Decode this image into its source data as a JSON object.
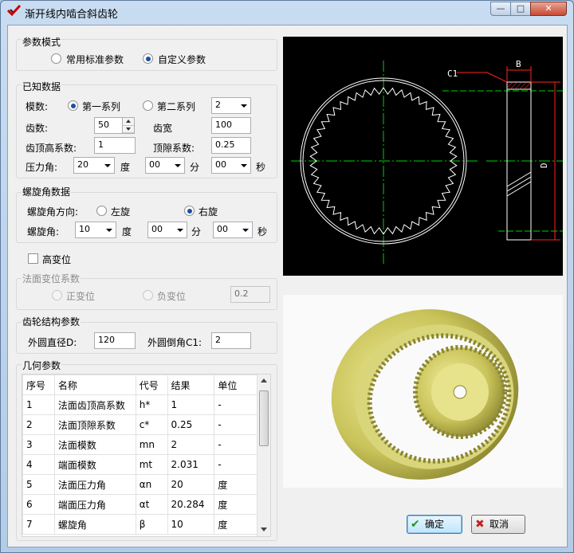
{
  "window": {
    "title": "渐开线内啮合斜齿轮",
    "controls": {
      "minimize": "—",
      "maximize": "□",
      "close": "✕"
    }
  },
  "param_mode": {
    "label": "参数模式",
    "options": [
      {
        "label": "常用标准参数",
        "selected": false
      },
      {
        "label": "自定义参数",
        "selected": true
      }
    ]
  },
  "known_data": {
    "label": "已知数据",
    "module_label": "模数:",
    "series1": "第一系列",
    "series2": "第二系列",
    "module_value": "2",
    "teeth_label": "齿数:",
    "teeth_value": "50",
    "face_width_label": "齿宽",
    "face_width_value": "100",
    "addendum_label": "齿顶高系数:",
    "addendum_value": "1",
    "clearance_label": "顶隙系数:",
    "clearance_value": "0.25",
    "pressure_label": "压力角:",
    "pressure_deg": "20",
    "pressure_min": "00",
    "pressure_sec": "00",
    "deg_unit": "度",
    "min_unit": "分",
    "sec_unit": "秒"
  },
  "helix": {
    "label": "螺旋角数据",
    "direction_label": "螺旋角方向:",
    "left": "左旋",
    "right": "右旋",
    "angle_label": "螺旋角:",
    "deg": "10",
    "min": "00",
    "sec": "00",
    "deg_unit": "度",
    "min_unit": "分",
    "sec_unit": "秒"
  },
  "modification": {
    "high_label": "高变位",
    "normal_label": "法面变位系数",
    "positive": "正变位",
    "negative": "负变位",
    "value": "0.2"
  },
  "structure": {
    "label": "齿轮结构参数",
    "od_label": "外圆直径D:",
    "od_value": "120",
    "chamfer_label": "外圆倒角C1:",
    "chamfer_value": "2"
  },
  "geometry": {
    "label": "几何参数",
    "columns": [
      "序号",
      "名称",
      "代号",
      "结果",
      "单位"
    ],
    "rows": [
      [
        "1",
        "法面齿顶高系数",
        "h*",
        "1",
        "-"
      ],
      [
        "2",
        "法面顶隙系数",
        "c*",
        "0.25",
        "-"
      ],
      [
        "3",
        "法面模数",
        "mn",
        "2",
        "-"
      ],
      [
        "4",
        "端面模数",
        "mt",
        "2.031",
        "-"
      ],
      [
        "5",
        "法面压力角",
        "αn",
        "20",
        "度"
      ],
      [
        "6",
        "端面压力角",
        "αt",
        "20.284",
        "度"
      ],
      [
        "7",
        "螺旋角",
        "β",
        "10",
        "度"
      ]
    ]
  },
  "drawing": {
    "c1": "C1",
    "b": "B",
    "d": "D"
  },
  "buttons": {
    "ok": "确定",
    "cancel": "取消"
  },
  "colors": {
    "accent": "#1c4fa0",
    "gear": "#c8c45a",
    "cad_line": "#00ff00"
  }
}
